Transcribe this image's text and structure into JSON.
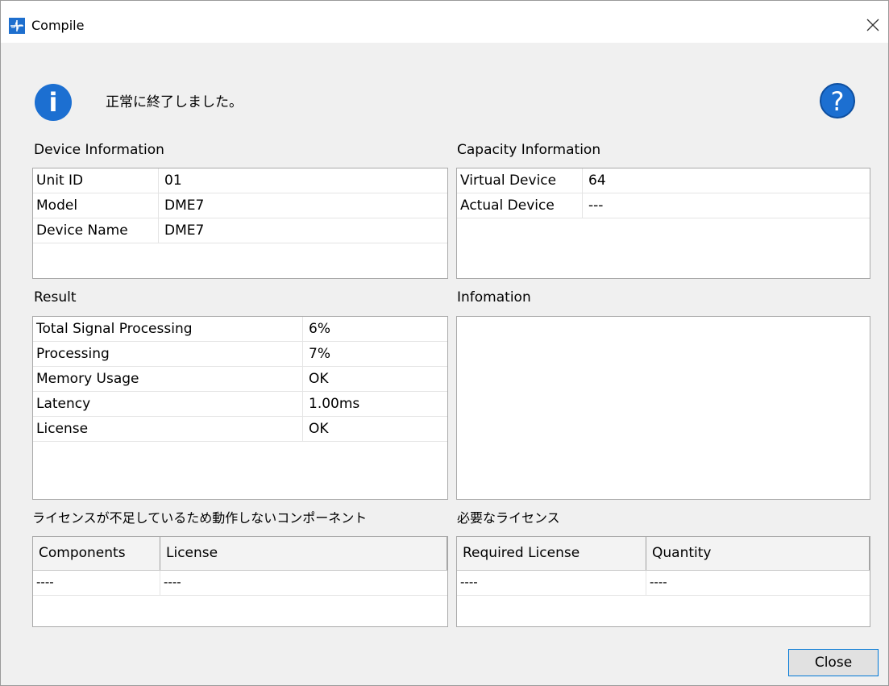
{
  "window": {
    "title": "Compile"
  },
  "message": {
    "text": "正常に終了しました。"
  },
  "device_information": {
    "label": "Device Information",
    "rows": [
      {
        "key": "Unit ID",
        "value": "01"
      },
      {
        "key": "Model",
        "value": "DME7"
      },
      {
        "key": "Device Name",
        "value": "DME7"
      }
    ]
  },
  "capacity_information": {
    "label": "Capacity Information",
    "rows": [
      {
        "key": "Virtual Device",
        "value": "64"
      },
      {
        "key": "Actual Device",
        "value": "---"
      }
    ]
  },
  "result": {
    "label": "Result",
    "rows": [
      {
        "key": "Total Signal Processing",
        "value": "6%"
      },
      {
        "key": "Processing",
        "value": "7%"
      },
      {
        "key": "Memory Usage",
        "value": "OK"
      },
      {
        "key": "Latency",
        "value": "1.00ms"
      },
      {
        "key": "License",
        "value": "OK"
      }
    ]
  },
  "infomation": {
    "label": "Infomation"
  },
  "unlicensed_components": {
    "label": "ライセンスが不足しているため動作しないコンポーネント",
    "columns": [
      "Components",
      "License"
    ],
    "rows": [
      [
        "----",
        "----"
      ]
    ]
  },
  "required_licenses": {
    "label": "必要なライセンス",
    "columns": [
      "Required License",
      "Quantity"
    ],
    "rows": [
      [
        "----",
        "----"
      ]
    ]
  },
  "buttons": {
    "close_label": "Close"
  },
  "colors": {
    "accent": "#1c6fd1",
    "focus_border": "#0078d7"
  }
}
